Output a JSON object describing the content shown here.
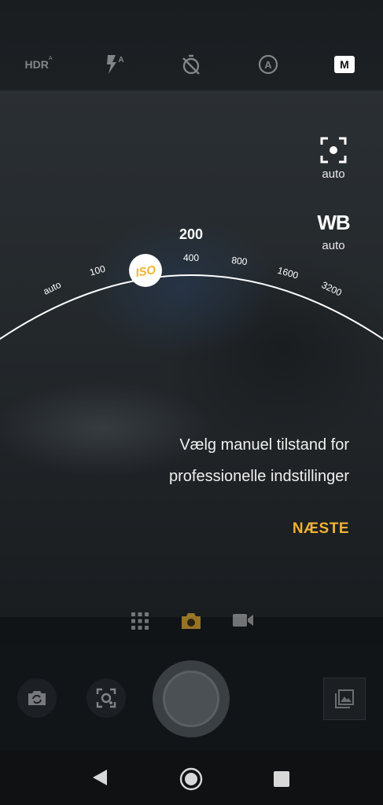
{
  "top_bar": {
    "hdr_label": "HDR",
    "hdr_badge": "A",
    "flash_badge": "A",
    "timer_icon": "timer-off-icon",
    "auto_mode_icon": "auto-mode-icon",
    "manual_label": "M"
  },
  "side_controls": {
    "focus_label": "auto",
    "wb_title": "WB",
    "wb_label": "auto"
  },
  "iso_dial": {
    "badge": "ISO",
    "current_value": "200",
    "ticks": [
      "auto",
      "100",
      "400",
      "800",
      "1600",
      "3200"
    ]
  },
  "tutorial": {
    "line1": "Vælg manuel tilstand for",
    "line2": "professionelle indstillinger",
    "next_label": "NÆSTE"
  },
  "modes": {
    "items": [
      "grid-icon",
      "camera-icon",
      "video-icon"
    ],
    "active": "camera-icon",
    "accent_color": "#F2B330"
  },
  "bottom_bar": {
    "switch_camera_icon": "switch-camera-icon",
    "lens_icon": "lens-icon",
    "gallery_icon": "gallery-icon"
  },
  "navigation": {
    "back_icon": "back-icon",
    "home_icon": "home-icon",
    "recents_icon": "recents-icon"
  }
}
